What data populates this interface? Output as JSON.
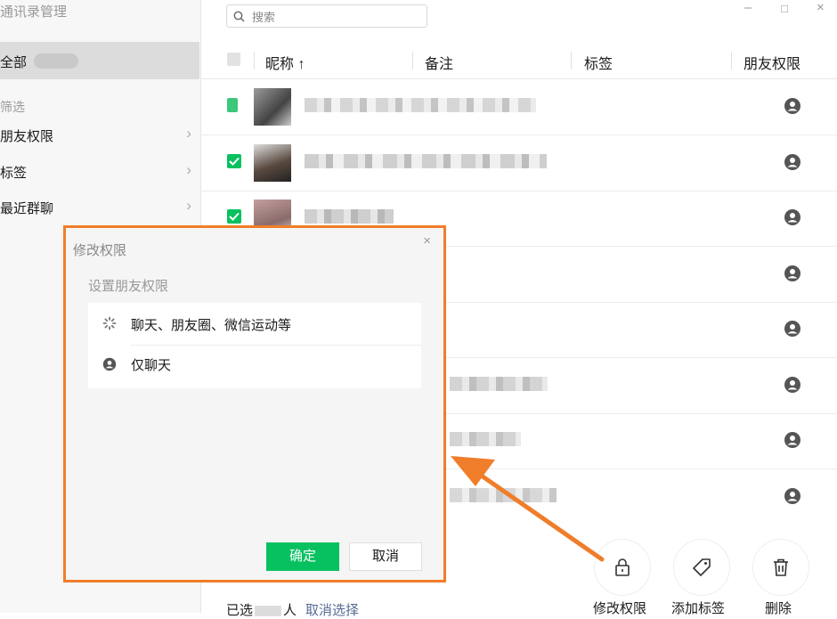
{
  "sidebar": {
    "title": "通讯录管理",
    "all_label": "全部",
    "filter_heading": "筛选",
    "items": [
      {
        "label": "朋友权限",
        "chevron": "›"
      },
      {
        "label": "标签",
        "chevron": "›"
      },
      {
        "label": "最近群聊",
        "chevron": "›"
      }
    ]
  },
  "search": {
    "placeholder": "搜索"
  },
  "window": {
    "minimize": "–",
    "maximize": "□",
    "close": "×"
  },
  "table": {
    "columns": {
      "nickname": "昵称 ↑",
      "remark": "备注",
      "tags": "标签",
      "permission": "朋友权限"
    }
  },
  "dialog": {
    "title": "修改权限",
    "close": "×",
    "subtitle": "设置朋友权限",
    "options": [
      {
        "label": "聊天、朋友圈、微信运动等",
        "icon": "loading-spinner-icon"
      },
      {
        "label": "仅聊天",
        "icon": "person-icon"
      }
    ],
    "ok_label": "确定",
    "cancel_label": "取消"
  },
  "bottom": {
    "selected_prefix": "已选",
    "selected_suffix": "人",
    "cancel_select": "取消选择",
    "actions": [
      {
        "label": "修改权限",
        "icon": "lock-icon"
      },
      {
        "label": "添加标签",
        "icon": "tag-icon"
      },
      {
        "label": "删除",
        "icon": "trash-icon"
      }
    ]
  },
  "colors": {
    "accent": "#07c160",
    "annotation": "#f07d2a",
    "link": "#576b95"
  }
}
